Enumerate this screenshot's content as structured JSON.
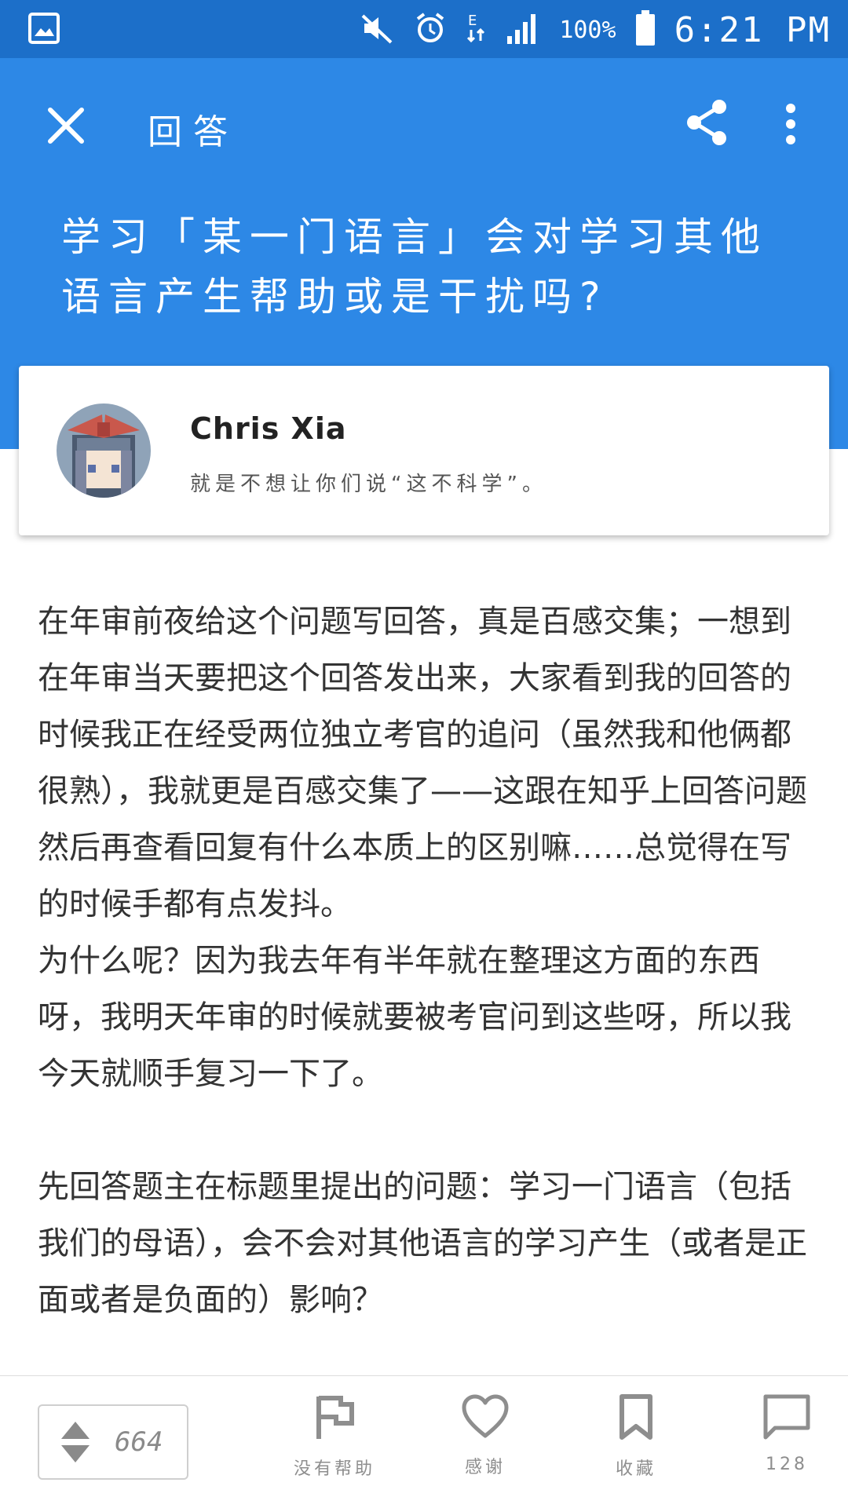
{
  "status_bar": {
    "battery": "100%",
    "time": "6:21 PM"
  },
  "toolbar": {
    "title": "回答"
  },
  "question": {
    "title": "学习「某一门语言」会对学习其他语言产生帮助或是干扰吗?"
  },
  "author": {
    "name": "Chris Xia",
    "bio": "就是不想让你们说“这不科学”。"
  },
  "answer": {
    "paragraphs": [
      "在年审前夜给这个问题写回答，真是百感交集；一想到在年审当天要把这个回答发出来，大家看到我的回答的时候我正在经受两位独立考官的追问（虽然我和他俩都很熟），我就更是百感交集了——这跟在知乎上回答问题然后再查看回复有什么本质上的区别嘛……总觉得在写的时候手都有点发抖。",
      "为什么呢？因为我去年有半年就在整理这方面的东西呀，我明天年审的时候就要被考官问到这些呀，所以我今天就顺手复习一下了。",
      "先回答题主在标题里提出的问题：学习一门语言（包括我们的母语），会不会对其他语言的学习产生（或者是正面或者是负面的）影响？"
    ]
  },
  "bottom_bar": {
    "vote_count": "664",
    "not_helpful_label": "没有帮助",
    "thanks_label": "感谢",
    "collect_label": "收藏",
    "comments_count": "128"
  },
  "colors": {
    "status_bar": "#1c6fc9",
    "header": "#2d88e6"
  }
}
